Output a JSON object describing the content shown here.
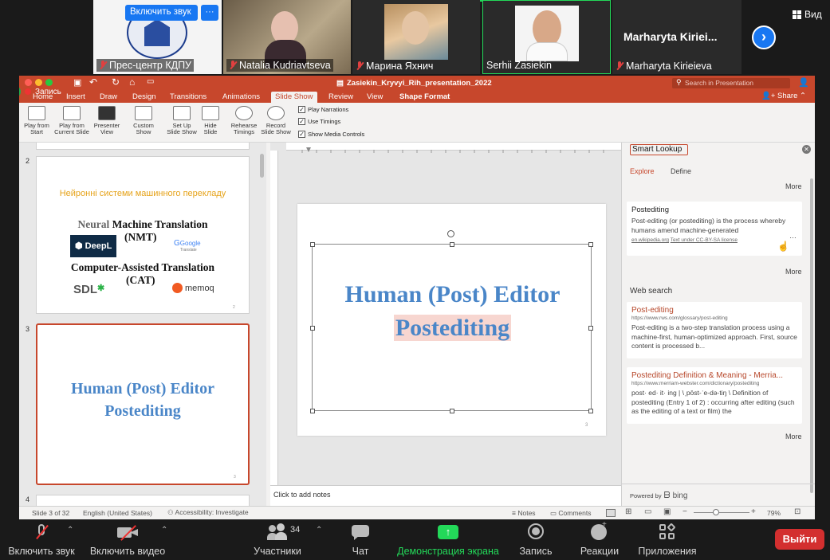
{
  "zoom_top": {
    "unmute_popup_label": "Включить звук",
    "more_label": "···",
    "view_label": "Вид",
    "participants": [
      {
        "name": "Прес-центр КДПУ"
      },
      {
        "name": "Natalia Kudriavtseva"
      },
      {
        "name": "Марина Яхнич"
      },
      {
        "name": "Serhii Zasiekin"
      },
      {
        "name": "Marharyta Kirieieva",
        "display": "Marharyta  Kiriei..."
      }
    ],
    "recording_label": "Запись"
  },
  "ppt": {
    "file_title": "Zasiekin_Kryvyi_Rih_presentation_2022",
    "search_placeholder": "Search in Presentation",
    "share_label": "Share",
    "tabs": [
      "Home",
      "Insert",
      "Draw",
      "Design",
      "Transitions",
      "Animations",
      "Slide Show",
      "Review",
      "View",
      "Shape Format"
    ],
    "active_tab": "Slide Show",
    "ribbon_buttons": [
      {
        "label": "Play from\nStart"
      },
      {
        "label": "Play from\nCurrent Slide"
      },
      {
        "label": "Presenter\nView"
      },
      {
        "label": "Custom\nShow"
      },
      {
        "label": "Set Up\nSlide Show"
      },
      {
        "label": "Hide\nSlide"
      },
      {
        "label": "Rehearse\nTimings"
      },
      {
        "label": "Record\nSlide Show"
      }
    ],
    "checkboxes": [
      "Play Narrations",
      "Use Timings",
      "Show Media Controls"
    ],
    "ruler_numbers": [
      "2",
      "1",
      "0",
      "1",
      "2",
      "3",
      "4",
      "5",
      "6",
      "7",
      "8",
      "9",
      "10",
      "11",
      "12",
      "13",
      "14",
      "15",
      "16",
      "17",
      "18",
      "19",
      "20",
      "21",
      "22",
      "23"
    ],
    "thumbnails": {
      "slide2": {
        "num": "2",
        "heading": "Нейронні системи машинного перекладу",
        "nmt_prefix": "Neural",
        "nmt_rest": "Machine Translation",
        "nmt_abbr": "(NMT)",
        "cat": "Computer-Assisted Translation",
        "cat_abbr": "(CAT)",
        "logo_deepl": "DeepL",
        "logo_google": "Google",
        "logo_google_sub": "Translate",
        "logo_sdl": "SDL",
        "logo_memoq": "memoq",
        "page": "2"
      },
      "slide3": {
        "num": "3",
        "line1": "Human (Post) Editor",
        "line2": "Postediting",
        "page": "3"
      },
      "slide4": {
        "num": "4"
      }
    },
    "slide": {
      "line1": "Human (Post) Editor",
      "line2": "Postediting",
      "page": "3"
    },
    "notes_placeholder": "Click to add notes",
    "smart_lookup": {
      "title": "Smart Lookup",
      "tab_explore": "Explore",
      "tab_define": "Define",
      "more": "More",
      "wiki_title": "Postediting",
      "wiki_text": "Post-editing (or postediting) is the process whereby humans amend machine-generated",
      "wiki_source": "en.wikipedia.org",
      "wiki_license": "Text under CC-BY-SA license",
      "web_search_label": "Web search",
      "results": [
        {
          "title": "Post-editing",
          "url": "https://www.rws.com/glossary/post-editing",
          "text": "Post-editing is a two-step translation process using a machine-first, human-optimized approach. First, source content is processed b..."
        },
        {
          "title": "Postediting Definition & Meaning - Merria...",
          "url": "https://www.merriam-webster.com/dictionary/postediting",
          "text": "post· ed· it· ing | \\ˌpōst-ˈe-də-tiŋ \\ Definition of postediting (Entry 1 of 2) : occurring after editing (such as the editing of a text or film) the"
        }
      ],
      "powered_by": "Powered by",
      "bing": "bing"
    },
    "status": {
      "slide_info": "Slide 3 of 32",
      "language": "English (United States)",
      "accessibility": "Accessibility: Investigate",
      "notes": "Notes",
      "comments": "Comments",
      "zoom": "79%"
    }
  },
  "zoom_bottom": {
    "unmute": "Включить звук",
    "video": "Включить видео",
    "participants": "Участники",
    "participants_count": "34",
    "chat": "Чат",
    "share": "Демонстрация экрана",
    "record": "Запись",
    "reactions": "Реакции",
    "apps": "Приложения",
    "leave": "Выйти"
  },
  "colors": {
    "ppt_accent": "#c7472c",
    "slide_text": "#4a86c8",
    "zoom_green": "#23d959",
    "leave_red": "#d32f2f"
  }
}
